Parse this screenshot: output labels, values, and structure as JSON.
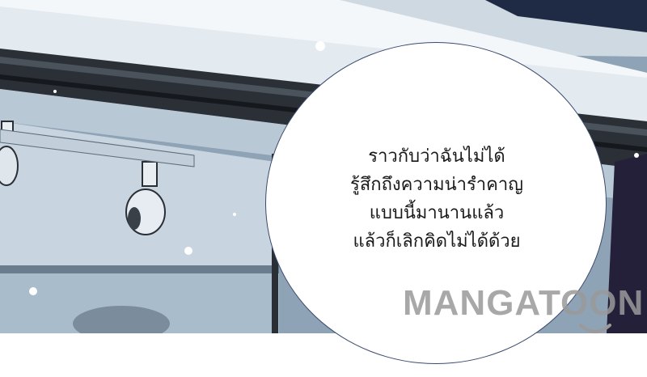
{
  "speech_bubble": {
    "lines": [
      "ราวกับว่าฉันไม่ได้",
      "รู้สึกถึงความน่ารำคาญ",
      "แบบนี้มานานแล้ว",
      "แล้วก็เลิกคิดไม่ได้ด้วย"
    ]
  },
  "watermark": {
    "text": "MANGATOON"
  },
  "colors": {
    "sky": "#7e93a8",
    "wall": "#d9e2ea",
    "dark_trim": "#2a2f35",
    "bubble_border": "#3b4a6e"
  },
  "icons": [
    "spotlight-icon",
    "snowflake-icon"
  ]
}
